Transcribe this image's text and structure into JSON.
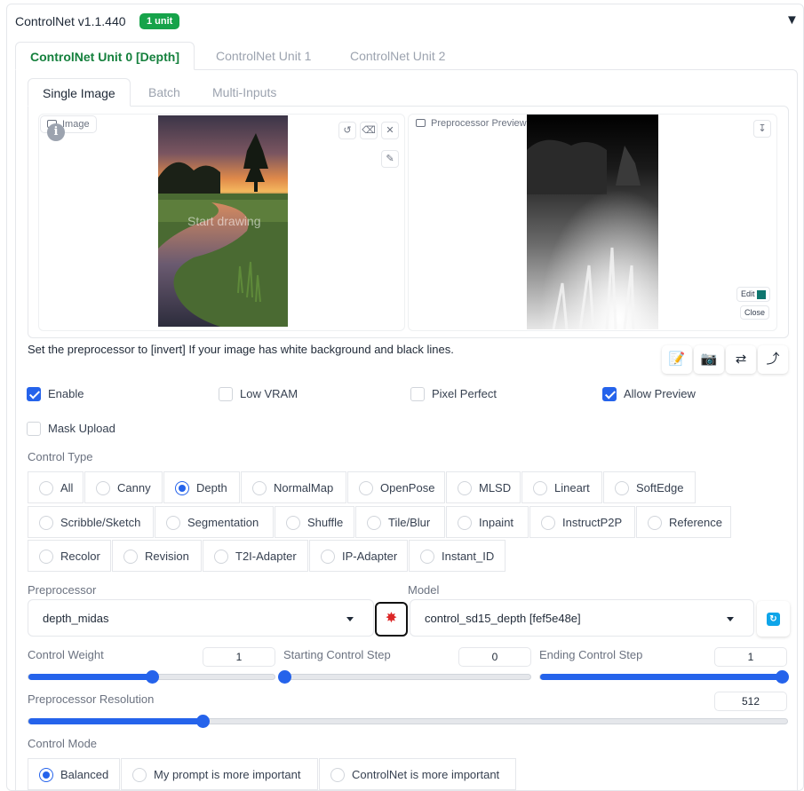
{
  "header": {
    "title": "ControlNet v1.1.440",
    "badge": "1 unit"
  },
  "unit_tabs": [
    "ControlNet Unit 0 [Depth]",
    "ControlNet Unit 1",
    "ControlNet Unit 2"
  ],
  "image_tabs": [
    "Single Image",
    "Batch",
    "Multi-Inputs"
  ],
  "image_panel": {
    "label": "Image",
    "placeholder": "Start drawing"
  },
  "preview_panel": {
    "label": "Preprocessor Preview",
    "edit_label": "Edit",
    "close_label": "Close"
  },
  "hint": "Set the preprocessor to [invert] If your image has white background and black lines.",
  "checkboxes": [
    {
      "label": "Enable",
      "checked": true
    },
    {
      "label": "Low VRAM",
      "checked": false
    },
    {
      "label": "Pixel Perfect",
      "checked": false
    },
    {
      "label": "Allow Preview",
      "checked": true
    },
    {
      "label": "Mask Upload",
      "checked": false
    }
  ],
  "control_type": {
    "label": "Control Type",
    "options": [
      "All",
      "Canny",
      "Depth",
      "NormalMap",
      "OpenPose",
      "MLSD",
      "Lineart",
      "SoftEdge",
      "Scribble/Sketch",
      "Segmentation",
      "Shuffle",
      "Tile/Blur",
      "Inpaint",
      "InstructP2P",
      "Reference",
      "Recolor",
      "Revision",
      "T2I-Adapter",
      "IP-Adapter",
      "Instant_ID"
    ],
    "selected": "Depth"
  },
  "preprocessor": {
    "label": "Preprocessor",
    "value": "depth_midas"
  },
  "model": {
    "label": "Model",
    "value": "control_sd15_depth [fef5e48e]"
  },
  "sliders": {
    "control_weight": {
      "label": "Control Weight",
      "value": "1",
      "fraction": 0.5
    },
    "starting_step": {
      "label": "Starting Control Step",
      "value": "0",
      "fraction": 0.0
    },
    "ending_step": {
      "label": "Ending Control Step",
      "value": "1",
      "fraction": 1.0
    },
    "resolution": {
      "label": "Preprocessor Resolution",
      "value": "512",
      "fraction": 0.23
    }
  },
  "control_mode": {
    "label": "Control Mode",
    "options": [
      "Balanced",
      "My prompt is more important",
      "ControlNet is more important"
    ],
    "selected": "Balanced"
  },
  "colors": {
    "accent": "#2563eb",
    "badge": "#16a34a",
    "active_tab": "#15803d"
  }
}
